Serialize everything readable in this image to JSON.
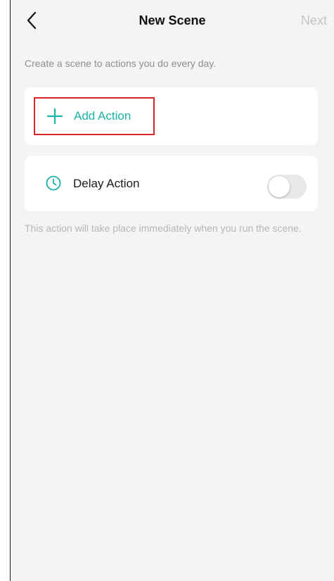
{
  "header": {
    "back_icon": "chevron-left-icon",
    "title": "New Scene",
    "next_label": "Next"
  },
  "subtitle": "Create a scene to actions you do every day.",
  "add_action": {
    "icon": "plus-icon",
    "label": "Add Action"
  },
  "delay_action": {
    "icon": "clock-icon",
    "label": "Delay Action",
    "enabled": false
  },
  "note": "This action will take place immediately when you run the scene.",
  "colors": {
    "accent": "#1ab3a6",
    "highlight_border": "#d9252b",
    "background": "#f4f4f4",
    "disabled_text": "#c3c3c3"
  }
}
